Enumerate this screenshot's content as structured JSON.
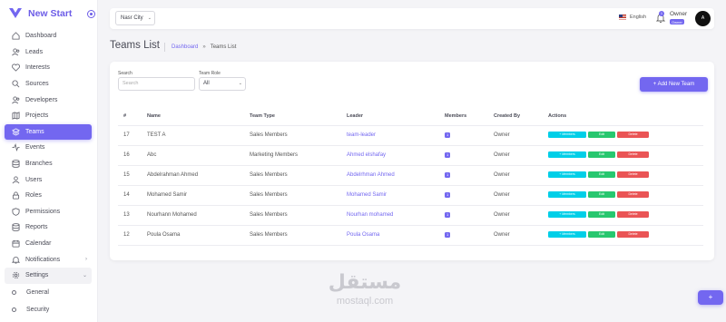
{
  "brand": {
    "name": "New Start"
  },
  "sidebar": {
    "items": [
      {
        "label": "Dashboard",
        "icon": "home-icon"
      },
      {
        "label": "Leads",
        "icon": "users-icon"
      },
      {
        "label": "Interests",
        "icon": "heart-icon"
      },
      {
        "label": "Sources",
        "icon": "search-icon"
      },
      {
        "label": "Developers",
        "icon": "users-icon"
      },
      {
        "label": "Projects",
        "icon": "map-icon"
      },
      {
        "label": "Teams",
        "icon": "layers-icon",
        "active": true
      },
      {
        "label": "Events",
        "icon": "activity-icon"
      },
      {
        "label": "Branches",
        "icon": "database-icon"
      },
      {
        "label": "Users",
        "icon": "user-icon"
      },
      {
        "label": "Roles",
        "icon": "lock-icon"
      },
      {
        "label": "Permissions",
        "icon": "shield-icon"
      },
      {
        "label": "Reports",
        "icon": "database-icon"
      },
      {
        "label": "Calendar",
        "icon": "calendar-icon"
      },
      {
        "label": "Notifications",
        "icon": "bell-icon",
        "chevron": ">"
      },
      {
        "label": "Settings",
        "icon": "gear-icon",
        "chevron": "v"
      }
    ],
    "sub_items": [
      {
        "label": "General"
      },
      {
        "label": "Security"
      }
    ]
  },
  "topbar": {
    "city": "Nasr City",
    "language": "English",
    "notification_count": "1",
    "user_name": "Owner",
    "user_role": "Owner",
    "avatar_initial": "A"
  },
  "page": {
    "title": "Teams List",
    "breadcrumb_home": "Dashboard",
    "breadcrumb_sep": "»",
    "breadcrumb_current": "Teams List"
  },
  "filters": {
    "search_label": "Search",
    "search_placeholder": "Search",
    "role_label": "Team Role",
    "role_value": "All"
  },
  "add_button": "+ Add New Team",
  "table": {
    "headers": [
      "#",
      "Name",
      "Team Type",
      "Leader",
      "Members",
      "Created By",
      "Actions"
    ],
    "rows": [
      {
        "id": "17",
        "name": "TEST A",
        "type": "Sales Members",
        "leader": "team-leader",
        "members": "1",
        "created_by": "Owner"
      },
      {
        "id": "16",
        "name": "Abc",
        "type": "Marketing Members",
        "leader": "Ahmed elshafay",
        "members": "1",
        "created_by": "Owner"
      },
      {
        "id": "15",
        "name": "Abdelrahman Ahmed",
        "type": "Sales Members",
        "leader": "Abdelrhman Ahmed",
        "members": "1",
        "created_by": "Owner"
      },
      {
        "id": "14",
        "name": "Mohamed Samir",
        "type": "Sales Members",
        "leader": "Mohamed Samir",
        "members": "1",
        "created_by": "Owner"
      },
      {
        "id": "13",
        "name": "Nourhann Mohamed",
        "type": "Sales Members",
        "leader": "Nourhan mohamed",
        "members": "1",
        "created_by": "Owner"
      },
      {
        "id": "12",
        "name": "Poula Osama",
        "type": "Sales Members",
        "leader": "Poula Osama",
        "members": "1",
        "created_by": "Owner"
      }
    ],
    "actions": {
      "members": "+ Members",
      "edit": "Edit",
      "delete": "Delete"
    }
  },
  "watermark": {
    "arabic": "مستقل",
    "latin": "mostaql.com"
  },
  "float_button": "+"
}
